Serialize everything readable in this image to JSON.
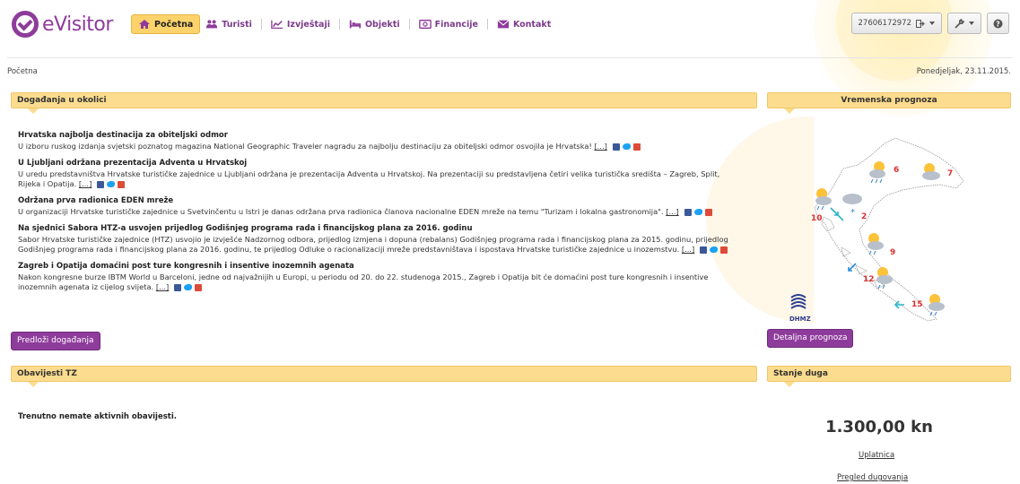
{
  "header": {
    "logo_text": "eVisitor",
    "nav": [
      {
        "label": "Početna",
        "icon": "home-icon"
      },
      {
        "label": "Turisti",
        "icon": "people-icon"
      },
      {
        "label": "Izvještaji",
        "icon": "chart-icon"
      },
      {
        "label": "Objekti",
        "icon": "bed-icon"
      },
      {
        "label": "Financije",
        "icon": "money-icon"
      },
      {
        "label": "Kontakt",
        "icon": "envelope-icon"
      }
    ],
    "user_id": "27606172972",
    "colors": {
      "brand": "#8e3c9b",
      "active_tab": "#fcd26b",
      "panel": "#fcdc8e"
    }
  },
  "breadcrumb": "Početna",
  "date": "Ponedjeljak, 23.11.2015.",
  "events": {
    "title": "Događanja u okolici",
    "items": [
      {
        "title": "Hrvatska najbolja destinacija za obiteljski odmor",
        "text": "U izboru ruskog izdanja svjetski poznatog magazina National Geographic Traveler nagradu za najbolju destinaciju za obiteljski odmor osvojila je Hrvatska!"
      },
      {
        "title": "U Ljubljani održana prezentacija Adventa u Hrvatskoj",
        "text": "U uredu predstavništva Hrvatske turističke zajednice u Ljubljani održana je prezentacija Adventa u Hrvatskoj. Na prezentaciji su predstavljena četiri velika turistička središta – Zagreb, Split, Rijeka i Opatija."
      },
      {
        "title": "Održana prva radionica EDEN mreže",
        "text": "U organizaciji Hrvatske turističke zajednice u Svetvinčentu u Istri je danas održana prva radionica članova nacionalne EDEN mreže na temu \"Turizam i lokalna gastronomija\"."
      },
      {
        "title": "Na sjednici Sabora HTZ-a usvojen prijedlog Godišnjeg programa rada i financijskog plana za 2016. godinu",
        "text": "Sabor Hrvatske turističke zajednice (HTZ) usvojio je izvješće Nadzornog odbora, prijedlog izmjena i dopuna (rebalans) Godišnjeg programa rada i financijskog plana za 2015. godinu, prijedlog Godišnjeg programa rada i financijskog plana za 2016. godinu, te prijedlog Odluke o racionalizaciji mreže predstavništava i ispostava Hrvatske turističke zajednice u inozemstvu."
      },
      {
        "title": "Zagreb i Opatija domaćini post ture kongresnih i insentive inozemnih agenata",
        "text": "Nakon kongresne burze IBTM World u Barceloni, jedne od najvažnijih u Europi, u periodu od 20. do 22. studenoga 2015., Zagreb i Opatija bit će domaćini post ture kongresnih i insentive inozemnih agenata iz cijelog svijeta."
      }
    ],
    "more_label": "[...]",
    "submit_label": "Predloži događanja"
  },
  "weather": {
    "title": "Vremenska prognoza",
    "temps": [
      "6",
      "7",
      "10",
      "2",
      "9",
      "12",
      "15"
    ],
    "source": "DHMZ",
    "detail_label": "Detaljna prognoza"
  },
  "notices": {
    "title": "Obavijesti TZ",
    "empty_text": "Trenutno nemate aktivnih obavijesti."
  },
  "debt": {
    "title": "Stanje duga",
    "amount": "1.300,00 kn",
    "payment_link": "Uplatnica",
    "overview_link": "Pregled dugovanja"
  }
}
